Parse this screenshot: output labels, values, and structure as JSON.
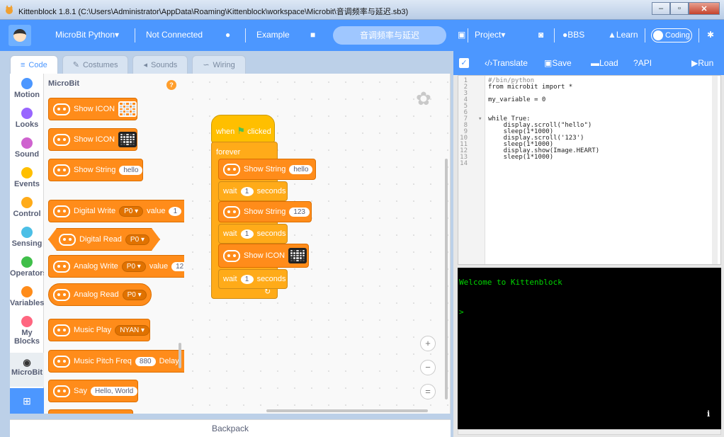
{
  "window": {
    "title": "Kittenblock 1.8.1 (C:\\Users\\Administrator\\AppData\\Roaming\\Kittenblock\\workspace\\Microbit\\音调频率与延迟.sb3)",
    "minimize": "‒",
    "maximize": "▫",
    "close": "✕"
  },
  "menubar": {
    "device": "MicroBit Python",
    "connection": "Not Connected",
    "example": "Example",
    "filename": "音调频率与延迟",
    "project": "Project",
    "bbs": "BBS",
    "learn": "Learn",
    "coding": "Coding"
  },
  "tabs": {
    "code": "Code",
    "costumes": "Costumes",
    "sounds": "Sounds",
    "wiring": "Wiring"
  },
  "categories": [
    {
      "label": "Motion",
      "color": "#4c97ff"
    },
    {
      "label": "Looks",
      "color": "#9966ff"
    },
    {
      "label": "Sound",
      "color": "#cf63cf"
    },
    {
      "label": "Events",
      "color": "#ffbf00"
    },
    {
      "label": "Control",
      "color": "#ffab19"
    },
    {
      "label": "Sensing",
      "color": "#4cbfe6"
    },
    {
      "label": "Operators",
      "color": "#40bf4a"
    },
    {
      "label": "Variables",
      "color": "#ff8c1a"
    },
    {
      "label": "My Blocks",
      "color": "#ff6680"
    },
    {
      "label": "MicroBit",
      "color": "#333333"
    }
  ],
  "palette": {
    "header": "MicroBit",
    "show_icon": "Show ICON",
    "show_string": "Show String",
    "show_string_value": "hello",
    "digital_write": "Digital Write",
    "digital_write_pin": "P0",
    "digital_write_value_label": "value",
    "digital_write_value": "1",
    "digital_read": "Digital Read",
    "digital_read_pin": "P0",
    "analog_write": "Analog Write",
    "analog_write_pin": "P0",
    "analog_write_value_label": "value",
    "analog_write_value": "12",
    "analog_read": "Analog Read",
    "analog_read_pin": "P0",
    "music_play": "Music Play",
    "music_play_tune": "NYAN",
    "music_pitch": "Music Pitch Freq",
    "music_pitch_freq": "880",
    "music_pitch_delay": "Delay",
    "say": "Say",
    "say_value": "Hello, World"
  },
  "script": {
    "hat": "when",
    "hat_suffix": "clicked",
    "forever": "forever",
    "show_string_1": "Show String",
    "show_string_1_value": "hello",
    "wait_label": "wait",
    "wait_unit": "seconds",
    "wait_1": "1",
    "show_string_2": "Show String",
    "show_string_2_value": "123",
    "wait_2": "1",
    "show_icon": "Show ICON",
    "wait_3": "1"
  },
  "workspace": {
    "zoom_in": "+",
    "zoom_out": "−",
    "reset": "="
  },
  "backpack": "Backpack",
  "right": {
    "translate": "Translate",
    "save": "Save",
    "load": "Load",
    "api": "API",
    "run": "Run",
    "code_lines": [
      "#/bin/python",
      "from microbit import *",
      "",
      "my_variable = 0",
      "",
      "",
      "while True:",
      "    display.scroll(\"hello\")",
      "    sleep(1*1000)",
      "    display.scroll('123')",
      "    sleep(1*1000)",
      "    display.show(Image.HEART)",
      "    sleep(1*1000)",
      ""
    ],
    "line_numbers": [
      "1",
      "2",
      "3",
      "4",
      "5",
      "6",
      "7",
      "8",
      "9",
      "10",
      "11",
      "12",
      "13",
      "14"
    ],
    "console_welcome": "Welcome to Kittenblock",
    "console_prompt": ">",
    "info_icon": "i"
  }
}
